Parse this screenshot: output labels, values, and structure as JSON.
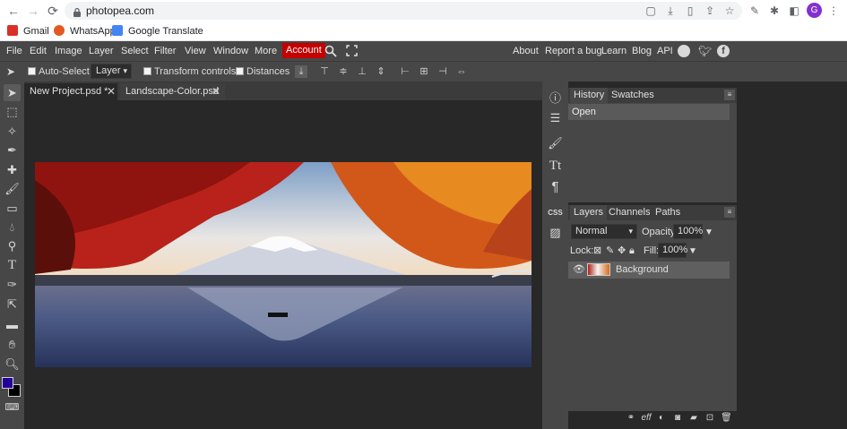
{
  "browser": {
    "url": "photopea.com",
    "profile_initial": "G",
    "bookmarks": [
      {
        "label": "Gmail",
        "icon": "gmail-icon",
        "color": "#d93025"
      },
      {
        "label": "WhatsApp",
        "icon": "whatsapp-icon",
        "color": "#e25822"
      },
      {
        "label": "Google Translate",
        "icon": "google-translate-icon",
        "color": "#4285f4"
      }
    ]
  },
  "menubar": {
    "items": [
      "File",
      "Edit",
      "Image",
      "Layer",
      "Select",
      "Filter",
      "View",
      "Window",
      "More"
    ],
    "account": "Account",
    "right_links": [
      "About",
      "Report a bug",
      "Learn",
      "Blog",
      "API"
    ]
  },
  "options": {
    "auto_select": "Auto-Select",
    "layer_select": "Layer",
    "transform_controls": "Transform controls",
    "distances": "Distances"
  },
  "tabs": [
    {
      "label": "New Project.psd *",
      "active": true
    },
    {
      "label": "Landscape-Color.psd",
      "active": false
    }
  ],
  "colors": {
    "foreground": "#230099",
    "background": "#000000",
    "account_bg": "#c40000"
  },
  "history_panel": {
    "tabs": [
      "History",
      "Swatches"
    ],
    "entries": [
      "Open"
    ]
  },
  "layers_panel": {
    "tabs": [
      "Layers",
      "Channels",
      "Paths"
    ],
    "blend_mode": "Normal",
    "opacity_label": "Opacity:",
    "opacity_value": "100%",
    "lock_label": "Lock:",
    "fill_label": "Fill:",
    "fill_value": "100%",
    "layers": [
      {
        "name": "Background",
        "visible": true
      }
    ]
  },
  "side_strip": {
    "css_label": "CSS"
  }
}
